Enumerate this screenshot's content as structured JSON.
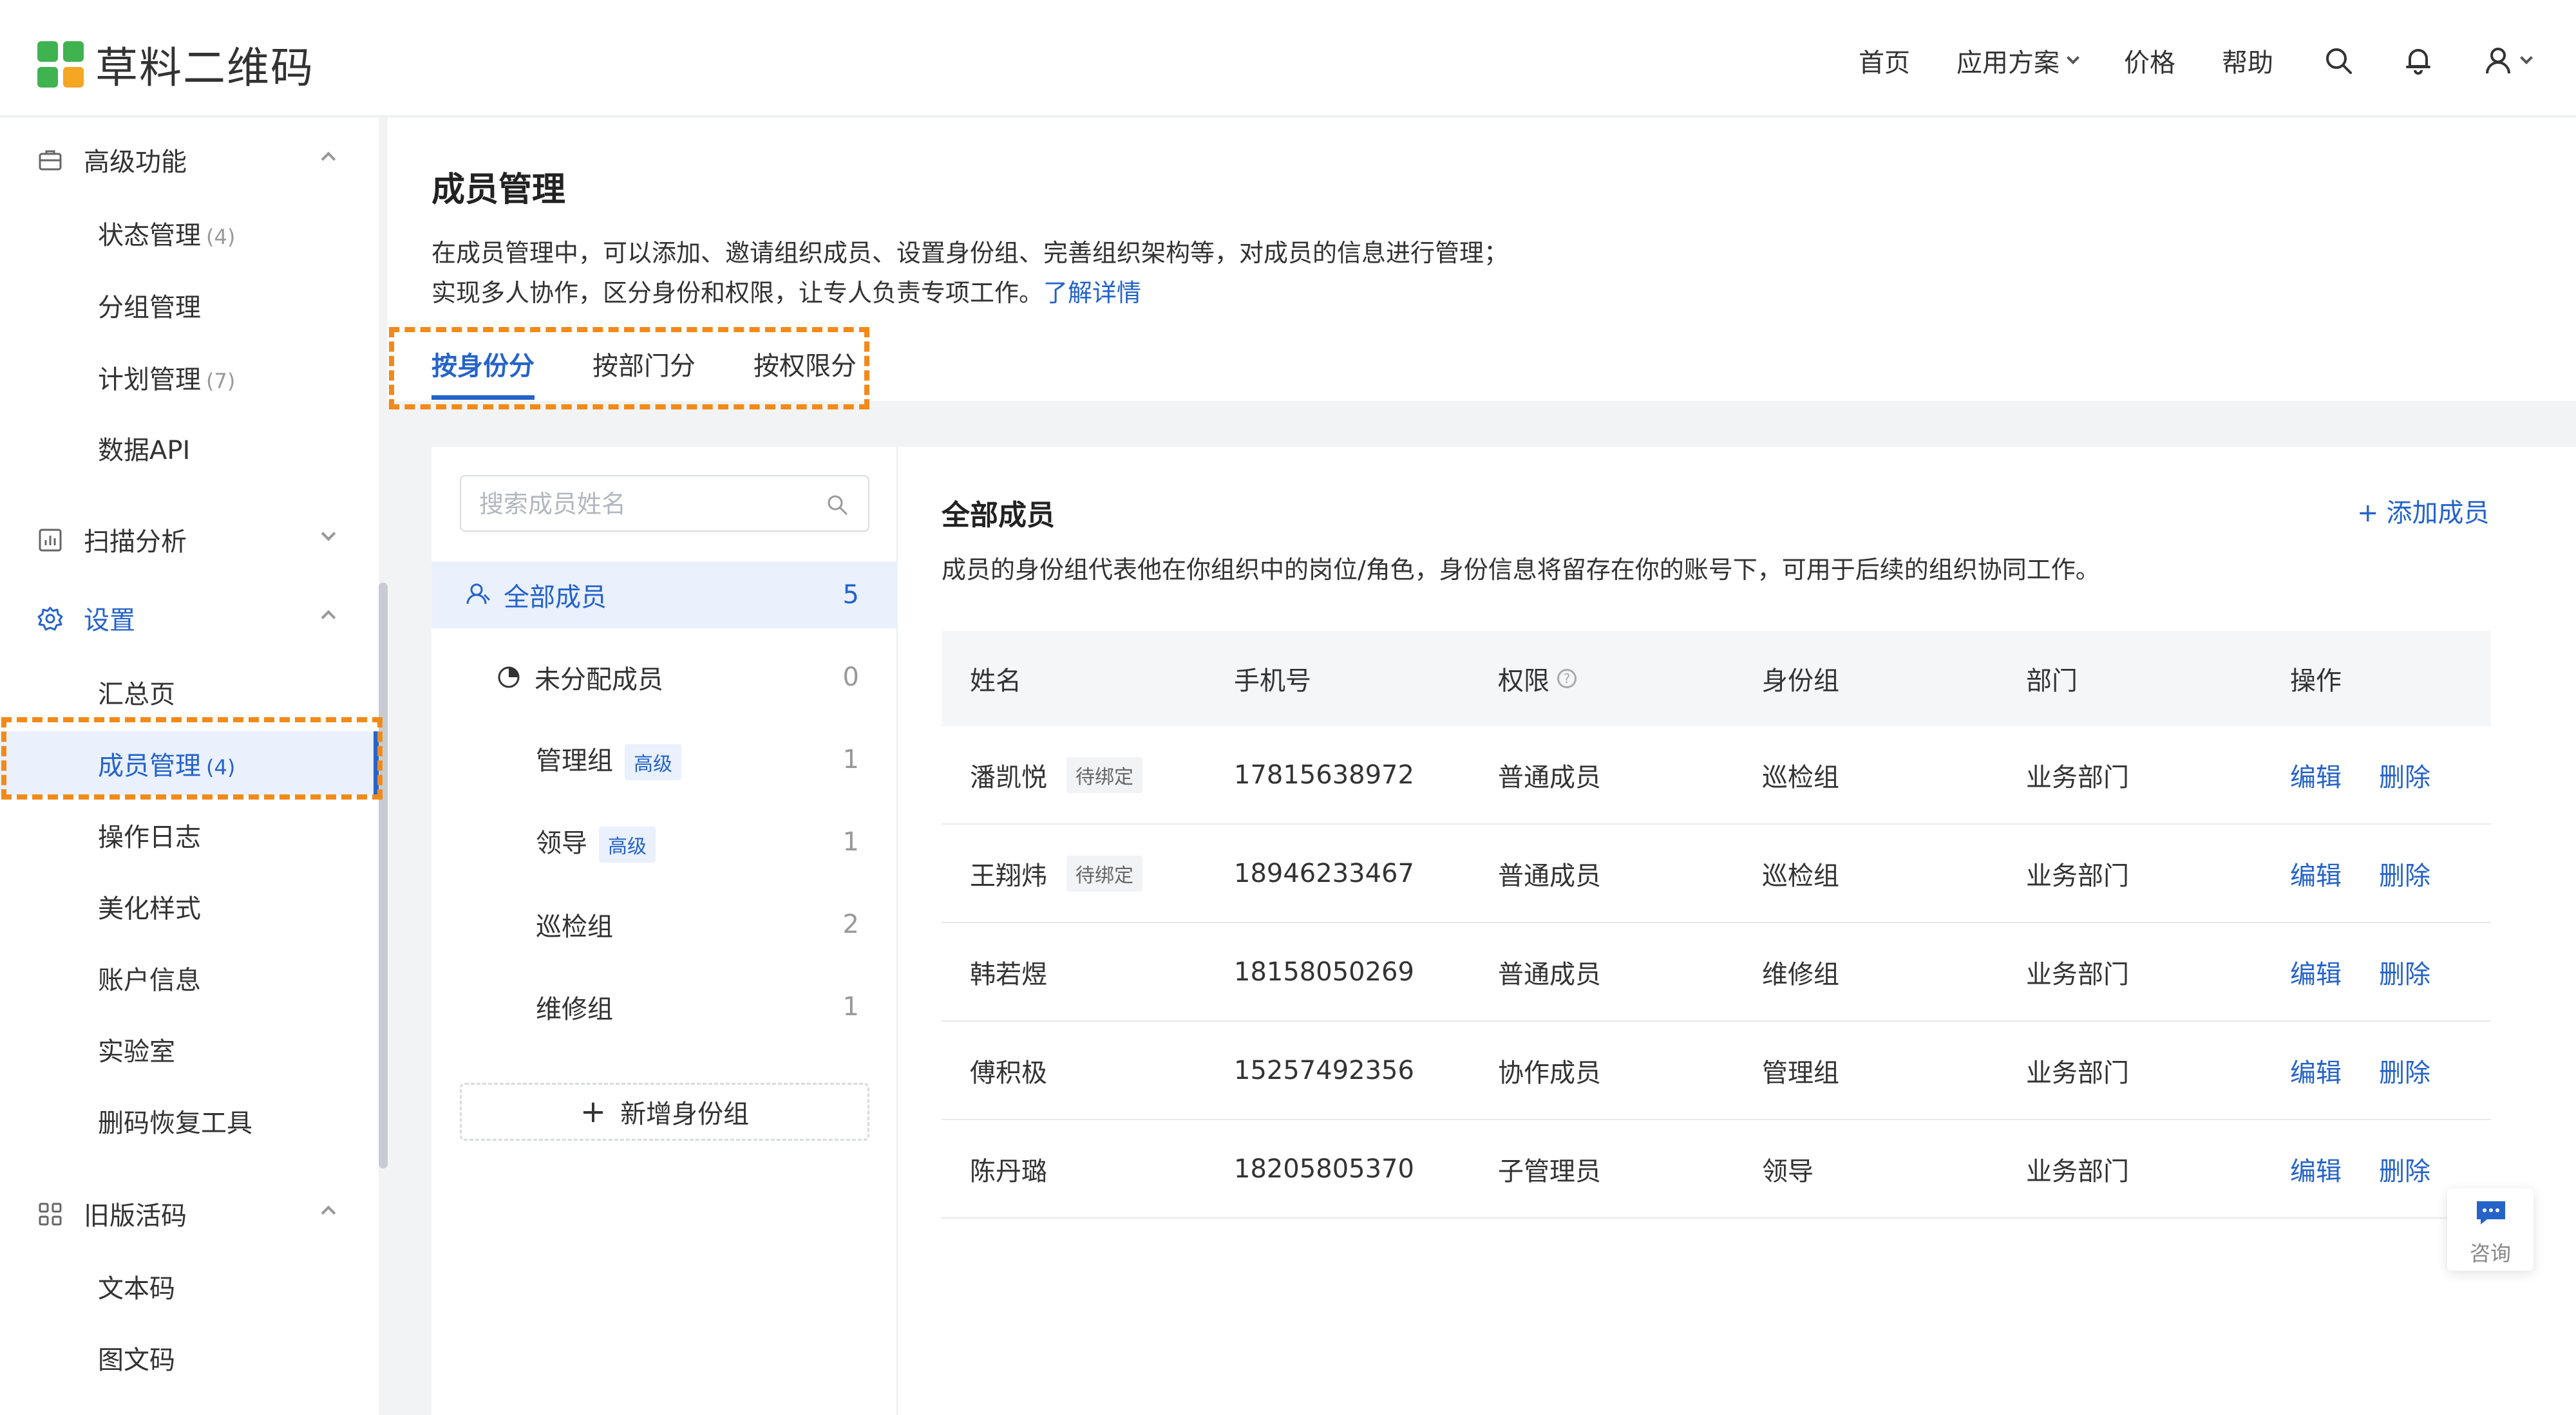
{
  "header": {
    "logo_text": "草料二维码",
    "nav": [
      "首页",
      "应用方案",
      "价格",
      "帮助"
    ],
    "icons": [
      "search-icon",
      "bell-icon",
      "user-icon"
    ]
  },
  "sidebar": {
    "groups": [
      {
        "label": "高级功能",
        "icon": "briefcase-icon",
        "expanded": true,
        "items": [
          {
            "label": "状态管理",
            "count": "(4)"
          },
          {
            "label": "分组管理",
            "count": ""
          },
          {
            "label": "计划管理",
            "count": "(7)"
          },
          {
            "label": "数据API",
            "count": ""
          }
        ]
      },
      {
        "label": "扫描分析",
        "icon": "bar-chart-icon",
        "expanded": false,
        "items": []
      },
      {
        "label": "设置",
        "icon": "gear-icon",
        "expanded": true,
        "items": [
          {
            "label": "汇总页",
            "count": ""
          },
          {
            "label": "成员管理",
            "count": "(4)"
          },
          {
            "label": "操作日志",
            "count": ""
          },
          {
            "label": "美化样式",
            "count": ""
          },
          {
            "label": "账户信息",
            "count": ""
          },
          {
            "label": "实验室",
            "count": ""
          },
          {
            "label": "删码恢复工具",
            "count": ""
          }
        ]
      },
      {
        "label": "旧版活码",
        "icon": "grid-icon",
        "expanded": true,
        "items": [
          {
            "label": "文本码",
            "count": ""
          },
          {
            "label": "图文码",
            "count": ""
          }
        ]
      }
    ]
  },
  "page": {
    "title": "成员管理",
    "desc_line1": "在成员管理中，可以添加、邀请组织成员、设置身份组、完善组织架构等，对成员的信息进行管理；",
    "desc_line2": "实现多人协作，区分身份和权限，让专人负责专项工作。",
    "learn_more": "了解详情",
    "tabs": [
      "按身份分",
      "按部门分",
      "按权限分"
    ]
  },
  "groups_panel": {
    "search_placeholder": "搜索成员姓名",
    "all": {
      "label": "全部成员",
      "count": "5"
    },
    "unassigned": {
      "label": "未分配成员",
      "count": "0"
    },
    "items": [
      {
        "label": "管理组",
        "tag": "高级",
        "count": "1"
      },
      {
        "label": "领导",
        "tag": "高级",
        "count": "1"
      },
      {
        "label": "巡检组",
        "tag": "",
        "count": "2"
      },
      {
        "label": "维修组",
        "tag": "",
        "count": "1"
      }
    ],
    "add_group": "新增身份组"
  },
  "members": {
    "title": "全部成员",
    "desc": "成员的身份组代表他在你组织中的岗位/角色，身份信息将留存在你的账号下，可用于后续的组织协同工作。",
    "add": "添加成员",
    "columns": [
      "姓名",
      "手机号",
      "权限",
      "身份组",
      "部门",
      "操作"
    ],
    "edit": "编辑",
    "delete": "删除",
    "rows": [
      {
        "name": "潘凯悦",
        "tag": "待绑定",
        "phone": "17815638972",
        "role": "普通成员",
        "group": "巡检组",
        "dept": "业务部门"
      },
      {
        "name": "王翔炜",
        "tag": "待绑定",
        "phone": "18946233467",
        "role": "普通成员",
        "group": "巡检组",
        "dept": "业务部门"
      },
      {
        "name": "韩若煜",
        "tag": "",
        "phone": "18158050269",
        "role": "普通成员",
        "group": "维修组",
        "dept": "业务部门"
      },
      {
        "name": "傅积极",
        "tag": "",
        "phone": "15257492356",
        "role": "协作成员",
        "group": "管理组",
        "dept": "业务部门"
      },
      {
        "name": "陈丹璐",
        "tag": "",
        "phone": "18205805370",
        "role": "子管理员",
        "group": "领导",
        "dept": "业务部门"
      }
    ]
  },
  "consult": {
    "label": "咨询"
  }
}
